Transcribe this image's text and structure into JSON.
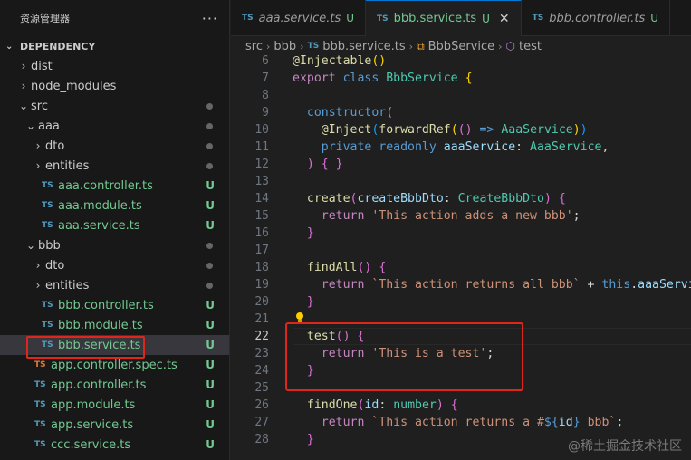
{
  "sidebar": {
    "title": "资源管理器",
    "more": "···",
    "section": "DEPENDENCY",
    "items": [
      {
        "chev": "›",
        "icon": "",
        "label": "dist",
        "status": "",
        "dot": false,
        "kind": "folder",
        "depth": 0
      },
      {
        "chev": "›",
        "icon": "",
        "label": "node_modules",
        "status": "",
        "dot": false,
        "kind": "folder",
        "depth": 0
      },
      {
        "chev": "⌄",
        "icon": "",
        "label": "src",
        "status": "",
        "dot": true,
        "kind": "folder",
        "depth": 0
      },
      {
        "chev": "⌄",
        "icon": "",
        "label": "aaa",
        "status": "",
        "dot": true,
        "kind": "folder",
        "depth": 1
      },
      {
        "chev": "›",
        "icon": "",
        "label": "dto",
        "status": "",
        "dot": true,
        "kind": "folder",
        "depth": 2
      },
      {
        "chev": "›",
        "icon": "",
        "label": "entities",
        "status": "",
        "dot": true,
        "kind": "folder",
        "depth": 2
      },
      {
        "chev": "",
        "icon": "TS",
        "label": "aaa.controller.ts",
        "status": "U",
        "dot": false,
        "kind": "file",
        "depth": 2
      },
      {
        "chev": "",
        "icon": "TS",
        "label": "aaa.module.ts",
        "status": "U",
        "dot": false,
        "kind": "file",
        "depth": 2
      },
      {
        "chev": "",
        "icon": "TS",
        "label": "aaa.service.ts",
        "status": "U",
        "dot": false,
        "kind": "file",
        "depth": 2
      },
      {
        "chev": "⌄",
        "icon": "",
        "label": "bbb",
        "status": "",
        "dot": true,
        "kind": "folder",
        "depth": 1
      },
      {
        "chev": "›",
        "icon": "",
        "label": "dto",
        "status": "",
        "dot": true,
        "kind": "folder",
        "depth": 2
      },
      {
        "chev": "›",
        "icon": "",
        "label": "entities",
        "status": "",
        "dot": true,
        "kind": "folder",
        "depth": 2
      },
      {
        "chev": "",
        "icon": "TS",
        "label": "bbb.controller.ts",
        "status": "U",
        "dot": false,
        "kind": "file",
        "depth": 2
      },
      {
        "chev": "",
        "icon": "TS",
        "label": "bbb.module.ts",
        "status": "U",
        "dot": false,
        "kind": "file",
        "depth": 2
      },
      {
        "chev": "",
        "icon": "TS",
        "label": "bbb.service.ts",
        "status": "U",
        "dot": false,
        "kind": "file",
        "depth": 2,
        "selected": true
      },
      {
        "chev": "",
        "icon": "TS",
        "label": "app.controller.spec.ts",
        "status": "U",
        "dot": false,
        "kind": "file",
        "depth": 1,
        "spec": true
      },
      {
        "chev": "",
        "icon": "TS",
        "label": "app.controller.ts",
        "status": "U",
        "dot": false,
        "kind": "file",
        "depth": 1
      },
      {
        "chev": "",
        "icon": "TS",
        "label": "app.module.ts",
        "status": "U",
        "dot": false,
        "kind": "file",
        "depth": 1
      },
      {
        "chev": "",
        "icon": "TS",
        "label": "app.service.ts",
        "status": "U",
        "dot": false,
        "kind": "file",
        "depth": 1
      },
      {
        "chev": "",
        "icon": "TS",
        "label": "ccc.service.ts",
        "status": "U",
        "dot": false,
        "kind": "file",
        "depth": 1
      }
    ]
  },
  "tabs": [
    {
      "icon": "TS",
      "name": "aaa.service.ts",
      "status": "U",
      "active": false
    },
    {
      "icon": "TS",
      "name": "bbb.service.ts",
      "status": "U",
      "active": true,
      "close": "✕"
    },
    {
      "icon": "TS",
      "name": "bbb.controller.ts",
      "status": "U",
      "active": false
    }
  ],
  "breadcrumb": {
    "src": "src",
    "bbb": "bbb",
    "file_icon": "TS",
    "file": "bbb.service.ts",
    "class": "BbbService",
    "method": "test"
  },
  "editor": {
    "current_line": 22,
    "lines": [
      {
        "n": 6,
        "t": [
          [
            "dec",
            "@Injectable"
          ],
          [
            "p1",
            "()"
          ]
        ]
      },
      {
        "n": 7,
        "t": [
          [
            "kw2",
            "export "
          ],
          [
            "kw",
            "class "
          ],
          [
            "cls",
            "BbbService "
          ],
          [
            "p1",
            "{"
          ]
        ]
      },
      {
        "n": 8,
        "t": []
      },
      {
        "n": 9,
        "t": [
          [
            "pl",
            "  "
          ],
          [
            "kw",
            "constructor"
          ],
          [
            "p2",
            "("
          ]
        ]
      },
      {
        "n": 10,
        "t": [
          [
            "pl",
            "    "
          ],
          [
            "dec",
            "@Inject"
          ],
          [
            "p3",
            "("
          ],
          [
            "fn",
            "forwardRef"
          ],
          [
            "p1",
            "("
          ],
          [
            "p2",
            "()"
          ],
          [
            "kw",
            " => "
          ],
          [
            "cls",
            "AaaService"
          ],
          [
            "p1",
            ")"
          ],
          [
            "p3",
            ")"
          ]
        ]
      },
      {
        "n": 11,
        "t": [
          [
            "pl",
            "    "
          ],
          [
            "kw",
            "private readonly "
          ],
          [
            "var",
            "aaaService"
          ],
          [
            "pl",
            ": "
          ],
          [
            "cls",
            "AaaService"
          ],
          [
            "pl",
            ","
          ]
        ]
      },
      {
        "n": 12,
        "t": [
          [
            "pl",
            "  "
          ],
          [
            "p2",
            ")"
          ],
          [
            "pl",
            " "
          ],
          [
            "p2",
            "{ }"
          ]
        ]
      },
      {
        "n": 13,
        "t": []
      },
      {
        "n": 14,
        "t": [
          [
            "pl",
            "  "
          ],
          [
            "fn",
            "create"
          ],
          [
            "p2",
            "("
          ],
          [
            "var",
            "createBbbDto"
          ],
          [
            "pl",
            ": "
          ],
          [
            "cls",
            "CreateBbbDto"
          ],
          [
            "p2",
            ")"
          ],
          [
            "pl",
            " "
          ],
          [
            "p2",
            "{"
          ]
        ]
      },
      {
        "n": 15,
        "t": [
          [
            "pl",
            "    "
          ],
          [
            "kw2",
            "return "
          ],
          [
            "str",
            "'This action adds a new bbb'"
          ],
          [
            "pl",
            ";"
          ]
        ]
      },
      {
        "n": 16,
        "t": [
          [
            "pl",
            "  "
          ],
          [
            "p2",
            "}"
          ]
        ]
      },
      {
        "n": 17,
        "t": []
      },
      {
        "n": 18,
        "t": [
          [
            "pl",
            "  "
          ],
          [
            "fn",
            "findAll"
          ],
          [
            "p2",
            "()"
          ],
          [
            "pl",
            " "
          ],
          [
            "p2",
            "{"
          ]
        ]
      },
      {
        "n": 19,
        "t": [
          [
            "pl",
            "    "
          ],
          [
            "kw2",
            "return "
          ],
          [
            "str",
            "`This action returns all bbb`"
          ],
          [
            "pl",
            " + "
          ],
          [
            "this",
            "this"
          ],
          [
            "pl",
            "."
          ],
          [
            "var",
            "aaaService"
          ]
        ]
      },
      {
        "n": 20,
        "t": [
          [
            "pl",
            "  "
          ],
          [
            "p2",
            "}"
          ]
        ]
      },
      {
        "n": 21,
        "t": []
      },
      {
        "n": 22,
        "t": [
          [
            "pl",
            "  "
          ],
          [
            "fn",
            "test"
          ],
          [
            "p2",
            "()"
          ],
          [
            "pl",
            " "
          ],
          [
            "p2",
            "{"
          ]
        ]
      },
      {
        "n": 23,
        "t": [
          [
            "pl",
            "    "
          ],
          [
            "kw2",
            "return "
          ],
          [
            "str",
            "'This is a test'"
          ],
          [
            "pl",
            ";"
          ]
        ]
      },
      {
        "n": 24,
        "t": [
          [
            "pl",
            "  "
          ],
          [
            "p2",
            "}"
          ]
        ]
      },
      {
        "n": 25,
        "t": []
      },
      {
        "n": 26,
        "t": [
          [
            "pl",
            "  "
          ],
          [
            "fn",
            "findOne"
          ],
          [
            "p2",
            "("
          ],
          [
            "var",
            "id"
          ],
          [
            "pl",
            ": "
          ],
          [
            "cls",
            "number"
          ],
          [
            "p2",
            ")"
          ],
          [
            "pl",
            " "
          ],
          [
            "p2",
            "{"
          ]
        ]
      },
      {
        "n": 27,
        "t": [
          [
            "pl",
            "    "
          ],
          [
            "kw2",
            "return "
          ],
          [
            "str",
            "`This action returns a #"
          ],
          [
            "kw",
            "${"
          ],
          [
            "var",
            "id"
          ],
          [
            "kw",
            "}"
          ],
          [
            "str",
            " bbb`"
          ],
          [
            "pl",
            ";"
          ]
        ]
      },
      {
        "n": 28,
        "t": [
          [
            "pl",
            "  "
          ],
          [
            "p2",
            "}"
          ]
        ]
      }
    ]
  },
  "watermark": "@稀土掘金技术社区"
}
